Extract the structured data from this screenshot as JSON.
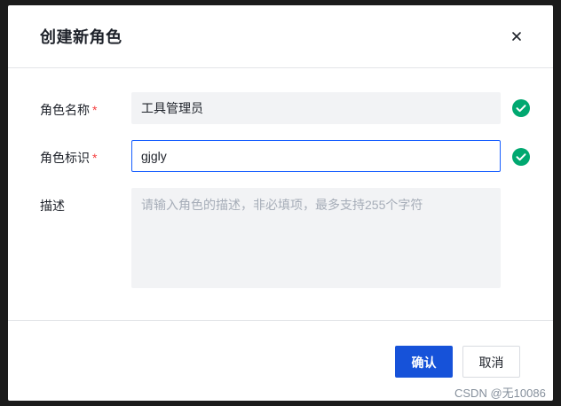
{
  "dialog": {
    "title": "创建新角色",
    "close_icon": "close-icon"
  },
  "form": {
    "role_name": {
      "label": "角色名称",
      "required_mark": "*",
      "value": "工具管理员",
      "status_icon": "check-circle-icon"
    },
    "role_key": {
      "label": "角色标识",
      "required_mark": "*",
      "value": "gjgly",
      "status_icon": "check-circle-icon"
    },
    "description": {
      "label": "描述",
      "placeholder": "请输入角色的描述，非必填项，最多支持255个字符",
      "value": ""
    }
  },
  "footer": {
    "confirm_label": "确认",
    "cancel_label": "取消"
  },
  "watermark": "CSDN @无10086",
  "colors": {
    "primary": "#1652d9",
    "success": "#00a870",
    "required": "#f53f3f",
    "focus_border": "#165dff"
  }
}
